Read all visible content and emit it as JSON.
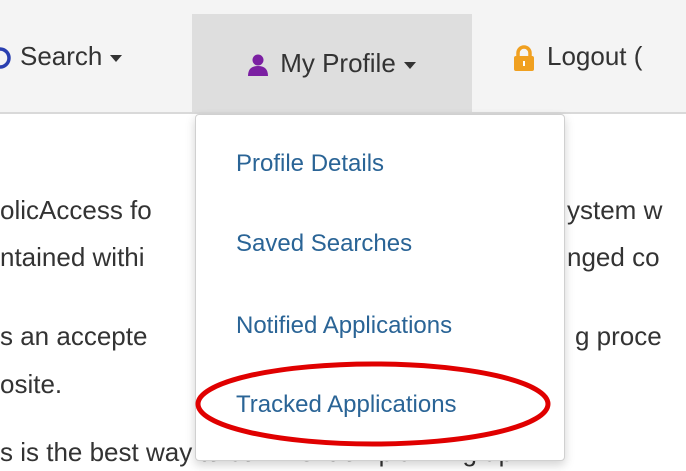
{
  "nav": {
    "search_label": "Search",
    "profile_label": "My Profile",
    "logout_label": "Logout ("
  },
  "content": {
    "lines": [
      "olicAccess fo",
      "ystem w",
      "ntained withi",
      "nged co",
      "s an accepte",
      "g proce",
      "osite.",
      "s is the best way to comment on planning ap"
    ]
  },
  "dropdown": {
    "items": [
      {
        "label": "Profile Details"
      },
      {
        "label": "Saved Searches"
      },
      {
        "label": "Notified Applications"
      },
      {
        "label": "Tracked Applications"
      }
    ]
  },
  "colors": {
    "link": "#2a6496",
    "profile_icon": "#7b1fa2",
    "lock_icon": "#f0a020",
    "highlight": "#e00000"
  }
}
